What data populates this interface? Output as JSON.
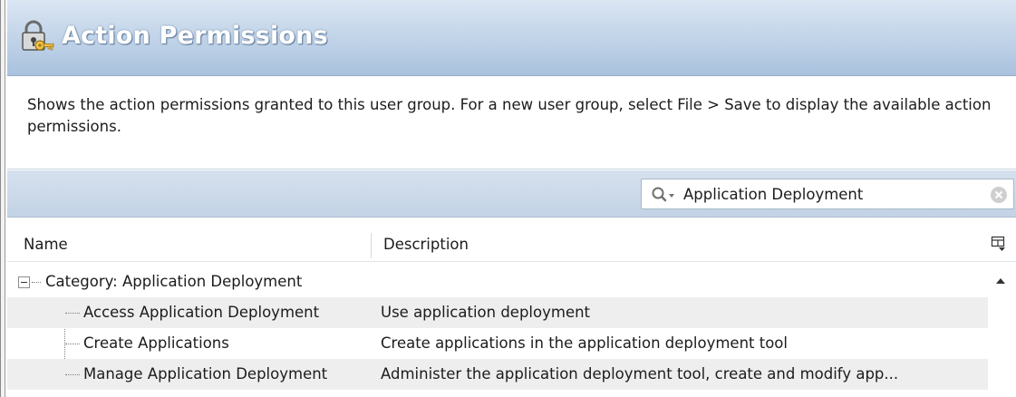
{
  "header": {
    "title": "Action Permissions",
    "icon": "keys-lock-icon"
  },
  "description": {
    "text": "Shows the action permissions granted to this user group. For a new user group, select File > Save to display the available action permissions."
  },
  "search": {
    "value": "Application Deployment",
    "icon": "search-icon",
    "clear_icon": "clear-icon"
  },
  "grid": {
    "columns": [
      "Name",
      "Description"
    ],
    "category": {
      "label": "Category: Application Deployment",
      "expanded": true
    },
    "rows": [
      {
        "name": "Access Application Deployment",
        "description": "Use application deployment"
      },
      {
        "name": "Create Applications",
        "description": "Create applications in the application deployment tool"
      },
      {
        "name": "Manage Application Deployment",
        "description": "Administer the application deployment tool, create and modify app..."
      }
    ]
  },
  "colors": {
    "header_top": "#dbe6f3",
    "header_bottom": "#a9c2de",
    "toolbar": "#c3d3e5",
    "alt_row": "#eeeeee"
  }
}
